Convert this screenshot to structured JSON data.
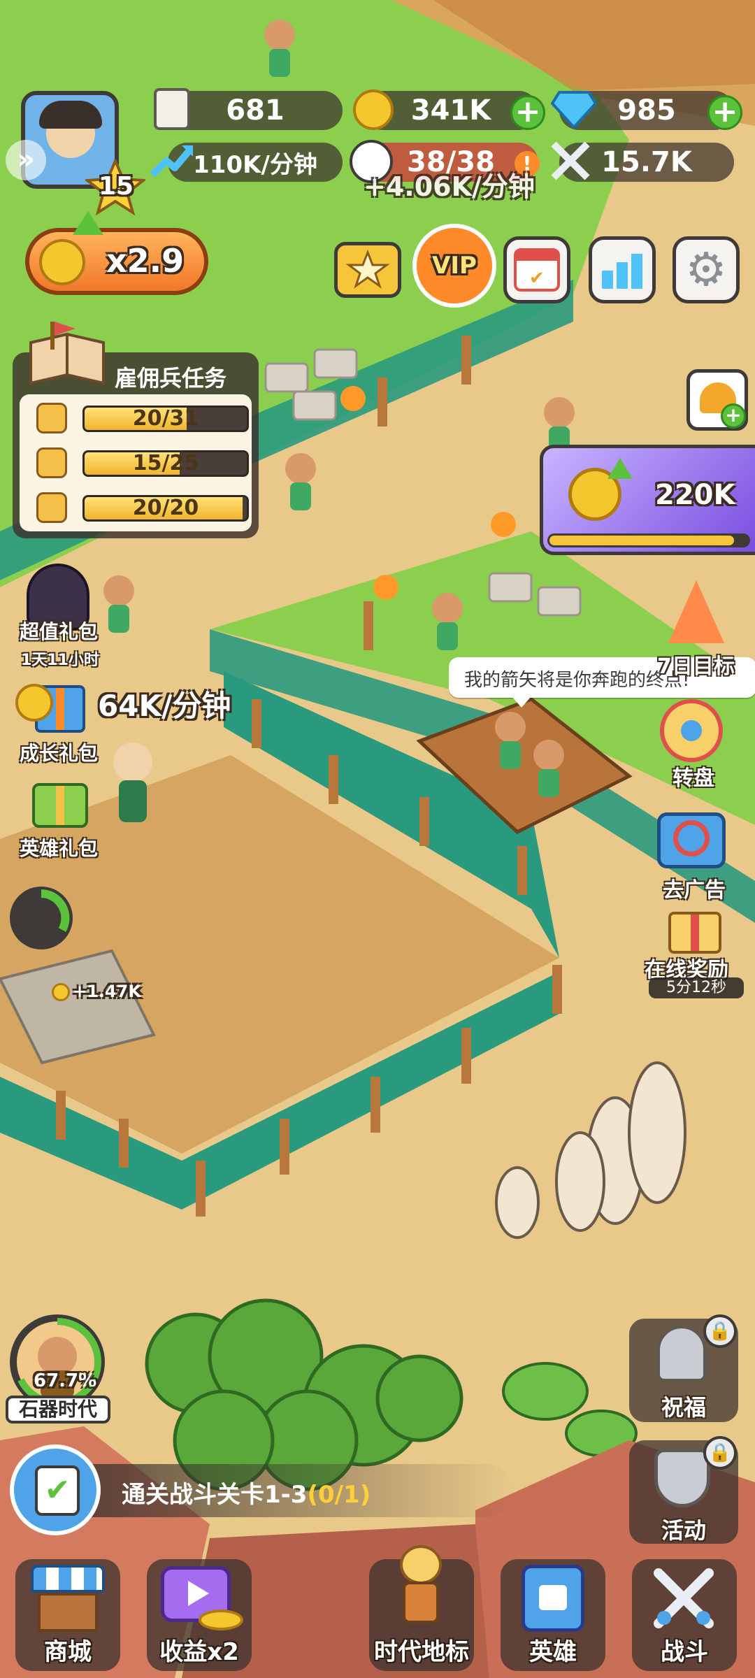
{
  "top_stats": {
    "bones": "681",
    "gold": "341K",
    "gems": "985",
    "income_rate": "110K/分钟",
    "population": "38/38",
    "power": "15.7K",
    "player_level": "15"
  },
  "floating": {
    "income_behind": "+4.06K/分钟",
    "farm_rate": "64K/分钟",
    "coin_popup": "+1.47K"
  },
  "boost": {
    "multiplier": "x2.9"
  },
  "quest_panel": {
    "title": "雇佣兵任务",
    "rows": [
      {
        "icon": "sword-icon",
        "text": "20/31",
        "progress": 0.645
      },
      {
        "icon": "bow-icon",
        "text": "15/25",
        "progress": 0.6
      },
      {
        "icon": "shield-icon",
        "text": "20/20",
        "progress": 1.0
      }
    ]
  },
  "top_buttons": {
    "vip": "VIP"
  },
  "coin_offer": {
    "value": "220K",
    "progress": 0.93
  },
  "left_side": {
    "value_pack": "超值礼包",
    "value_pack_timer": "1天11小时",
    "growth_pack": "成长礼包",
    "hero_pack": "英雄礼包"
  },
  "right_side": {
    "seven_day": "7日目标",
    "wheel": "转盘",
    "no_ads": "去广告",
    "online_reward": "在线奖励",
    "online_timer": "5分12秒",
    "blessing": "祝福",
    "activity": "活动"
  },
  "speech_bubble": "我的箭矢将是你奔跑的终点!",
  "era": {
    "name": "石器时代",
    "progress_text": "67.7%",
    "progress": 0.677
  },
  "mission": {
    "text": "通关战斗关卡1-3",
    "count": "(0/1)"
  },
  "bottom_nav": [
    {
      "label": "商城",
      "icon": "shop-icon"
    },
    {
      "label": "收益x2",
      "icon": "video-icon"
    },
    {
      "label": "时代地标",
      "icon": "landmark-icon"
    },
    {
      "label": "英雄",
      "icon": "hero-card-icon"
    },
    {
      "label": "战斗",
      "icon": "crossed-swords-icon"
    }
  ],
  "colors": {
    "grass": "#8ccf4e",
    "sand": "#e9c98a",
    "fence": "#2a9a7e",
    "gold": "#f5c72f",
    "accent_green": "#5cc23c"
  }
}
